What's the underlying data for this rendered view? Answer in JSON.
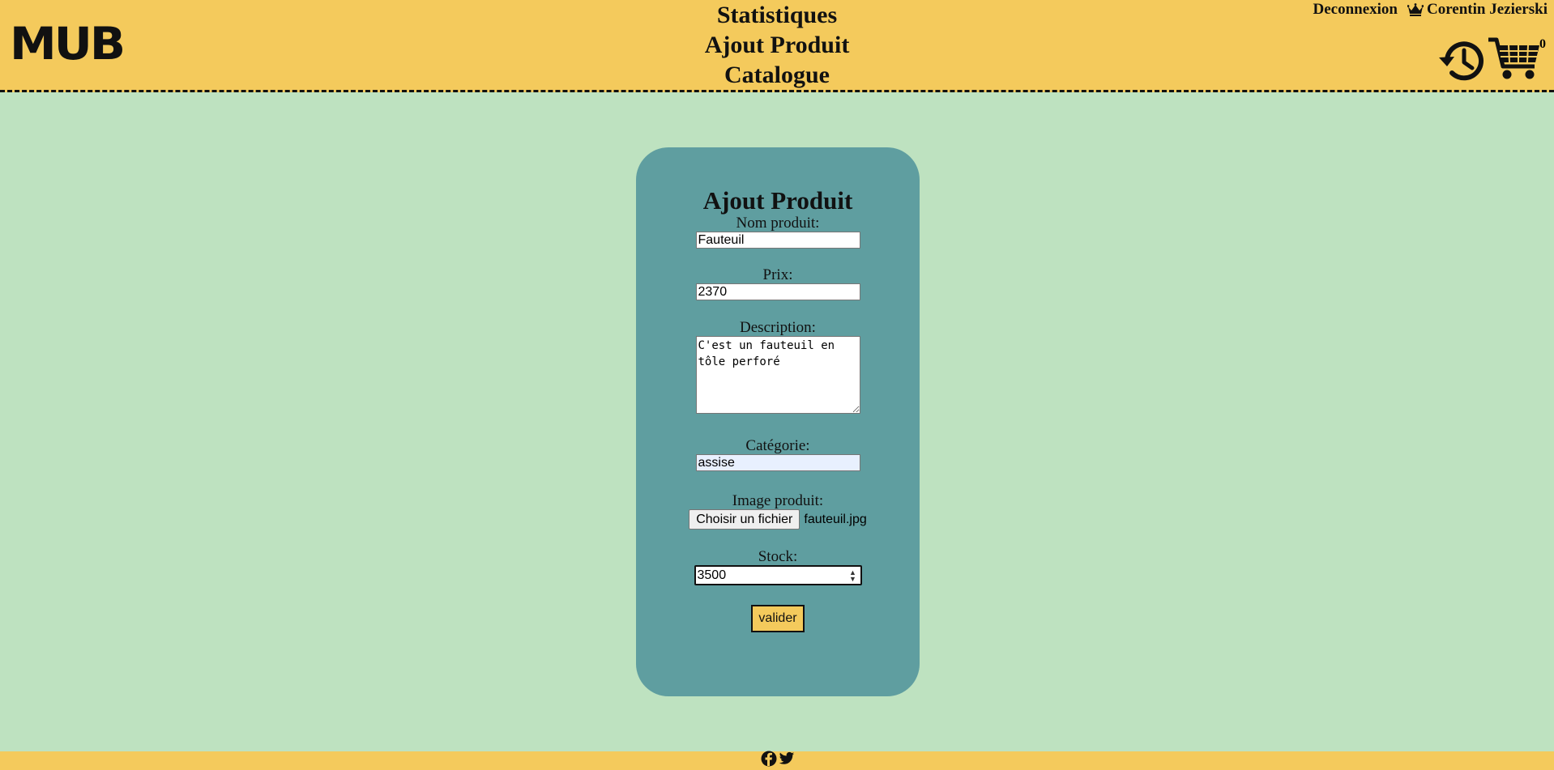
{
  "header": {
    "logo": "MUB",
    "nav": [
      "Statistiques",
      "Ajout Produit",
      "Catalogue"
    ],
    "logout": "Deconnexion",
    "user_name": "Corentin Jezierski",
    "user_icon": "crown-icon",
    "history_icon": "history-icon",
    "cart_icon": "cart-icon",
    "cart_count": "0"
  },
  "form": {
    "title": "Ajout Produit",
    "name_label": "Nom produit:",
    "name_value": "Fauteuil",
    "price_label": "Prix:",
    "price_value": "2370",
    "description_label": "Description:",
    "description_value": "C'est un fauteuil en tôle perforé",
    "category_label": "Catégorie:",
    "category_value": "assise",
    "image_label": "Image produit:",
    "image_button": "Choisir un fichier",
    "image_filename": "fauteuil.jpg",
    "stock_label": "Stock:",
    "stock_value": "3500",
    "submit_label": "valider"
  },
  "footer": {
    "icons": [
      "facebook-icon",
      "twitter-icon"
    ]
  },
  "colors": {
    "header_bg": "#f4ca5c",
    "page_bg": "#bee2c0",
    "card_bg": "#5f9ea0",
    "autofill_bg": "#e8f0fe"
  }
}
